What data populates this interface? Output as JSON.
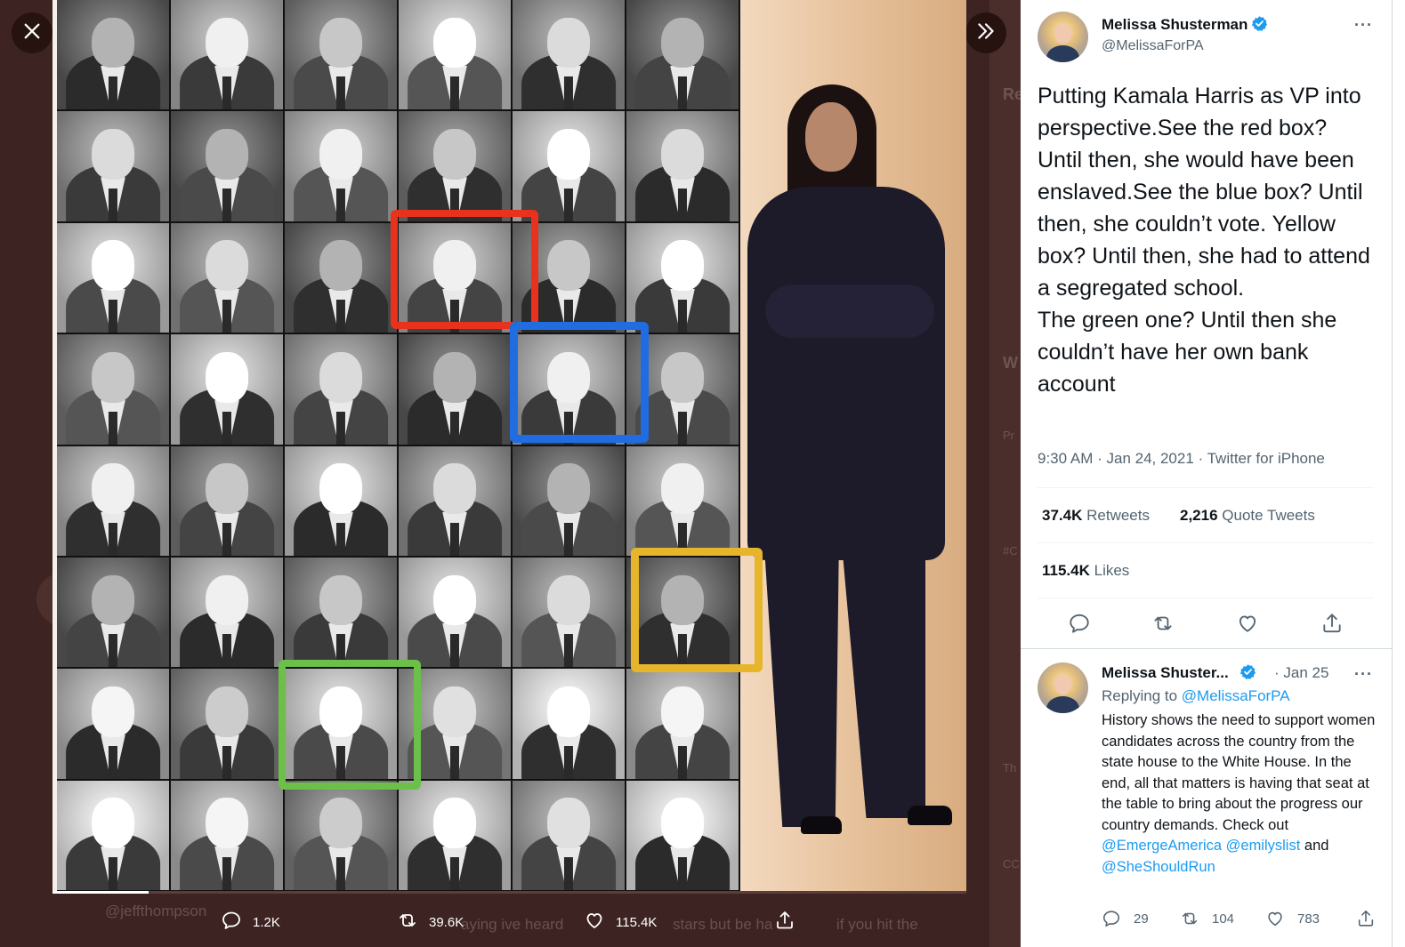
{
  "viewer": {
    "close_icon": "close-icon",
    "expand_icon": "double-chevron-right-icon",
    "image_alt": "Grid of U.S. vice-president portraits with red, blue, yellow and green boxes next to a photo of Kamala Harris",
    "progress": 0.105,
    "under_text": {
      "handle": "@jeffthompson",
      "reply_snippet": "aying ive heard",
      "reply_snippet2": "stars but be ha",
      "reply_snippet3": "if you hit the"
    },
    "actions": {
      "reply_count": "1.2K",
      "retweet_count": "39.6K",
      "like_count": "115.4K"
    }
  },
  "tweet": {
    "author_name": "Melissa Shusterman",
    "author_handle": "@MelissaForPA",
    "text": "Putting Kamala Harris as VP into perspective.See the red box?  Until then, she would have been enslaved.See the blue box? Until then, she couldn’t vote. Yellow box? Until then, she had to attend a segregated school.\nThe green one? Until then she couldn’t have her own bank account",
    "time": "9:30 AM",
    "date": "Jan 24, 2021",
    "source": "Twitter for iPhone",
    "retweets_count": "37.4K",
    "retweets_label": "Retweets",
    "quotes_count": "2,216",
    "quotes_label": "Quote Tweets",
    "likes_count": "115.4K",
    "likes_label": "Likes"
  },
  "reply": {
    "author_name": "Melissa Shuster...",
    "date": "Jan 25",
    "replying_to_label": "Replying to",
    "replying_to_handle": "@MelissaForPA",
    "text": "History shows the need to support women candidates across the country from the state house to the White House. In the end, all that matters is having that seat at the table to bring about the progress our country demands. Check out",
    "mention1": "@EmergeAmerica",
    "mention2": "@emilyslist",
    "and": "and",
    "mention3": "@SheShouldRun",
    "reply_count": "29",
    "retweet_count": "104",
    "like_count": "783"
  },
  "colors": {
    "accent": "#1d9bf0",
    "red_box": "#e8321e",
    "blue_box": "#1f6de0",
    "yellow_box": "#e6b52b",
    "green_box": "#6cc04a"
  }
}
